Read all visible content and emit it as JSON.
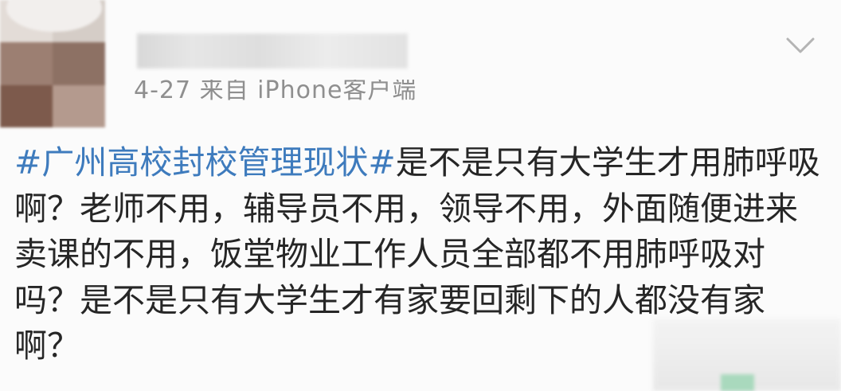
{
  "post": {
    "meta_text": "4-27  来自 iPhone客户端",
    "hashtag": "#广州高校封校管理现状#",
    "body": "是不是只有大学生才用肺呼吸啊？老师不用，辅导员不用，领导不用，外面随便进来卖课的不用，饭堂物业工作人员全部都不用肺呼吸对吗？是不是只有大学生才有家要回剩下的人都没有家啊？"
  },
  "colors": {
    "hashtag": "#3e7bbd",
    "text": "#262626",
    "meta": "#8f8f8f"
  },
  "icons": {
    "menu": "chevron-down-icon"
  }
}
